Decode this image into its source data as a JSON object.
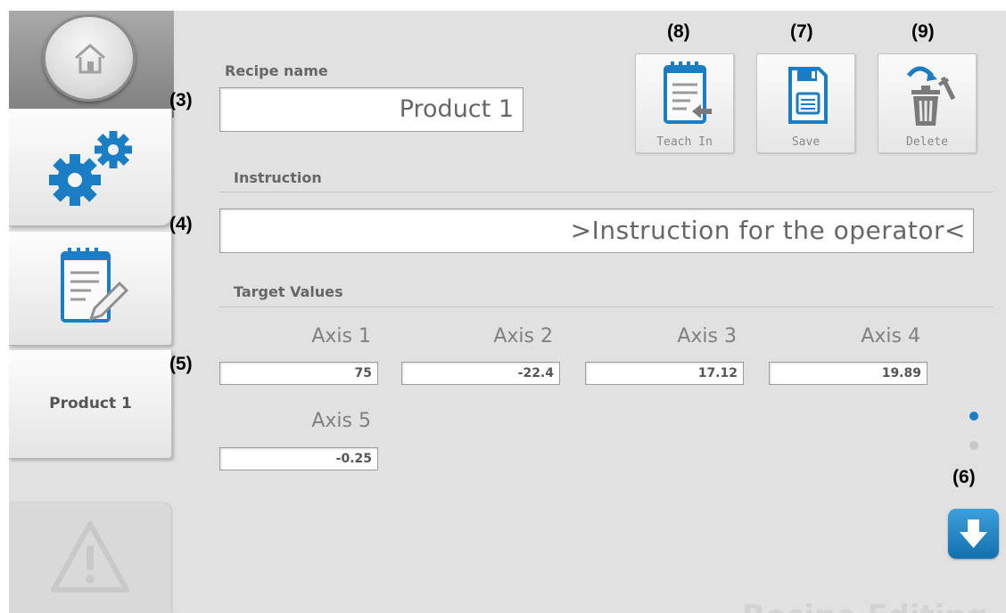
{
  "sidebar": {
    "home_icon": "home-icon",
    "settings_icon": "gears-icon",
    "recipe_icon": "notepad-edit-icon",
    "product_label": "Product 1",
    "alarm_icon": "warning-triangle-icon"
  },
  "recipe": {
    "label": "Recipe name",
    "value": "Product 1"
  },
  "instruction": {
    "label": "Instruction",
    "value": ">Instruction for the operator<"
  },
  "target": {
    "label": "Target Values",
    "axes": [
      {
        "name": "Axis 1",
        "value": "75"
      },
      {
        "name": "Axis 2",
        "value": "-22.4"
      },
      {
        "name": "Axis 3",
        "value": "17.12"
      },
      {
        "name": "Axis 4",
        "value": "19.89"
      },
      {
        "name": "Axis 5",
        "value": "-0.25"
      }
    ]
  },
  "actions": {
    "teach_in": "Teach In",
    "save": "Save",
    "delete": "Delete"
  },
  "callouts": {
    "c3": "(3)",
    "c4": "(4)",
    "c5": "(5)",
    "c6": "(6)",
    "c7": "(7)",
    "c8": "(8)",
    "c9": "(9)"
  },
  "pager": {
    "current_page": 1,
    "total_pages": 2
  },
  "watermark": "Recipe Editing",
  "colors": {
    "accent": "#1b7ec4",
    "background": "#e1e1e1",
    "inactive_dot": "#c8c8c8"
  }
}
